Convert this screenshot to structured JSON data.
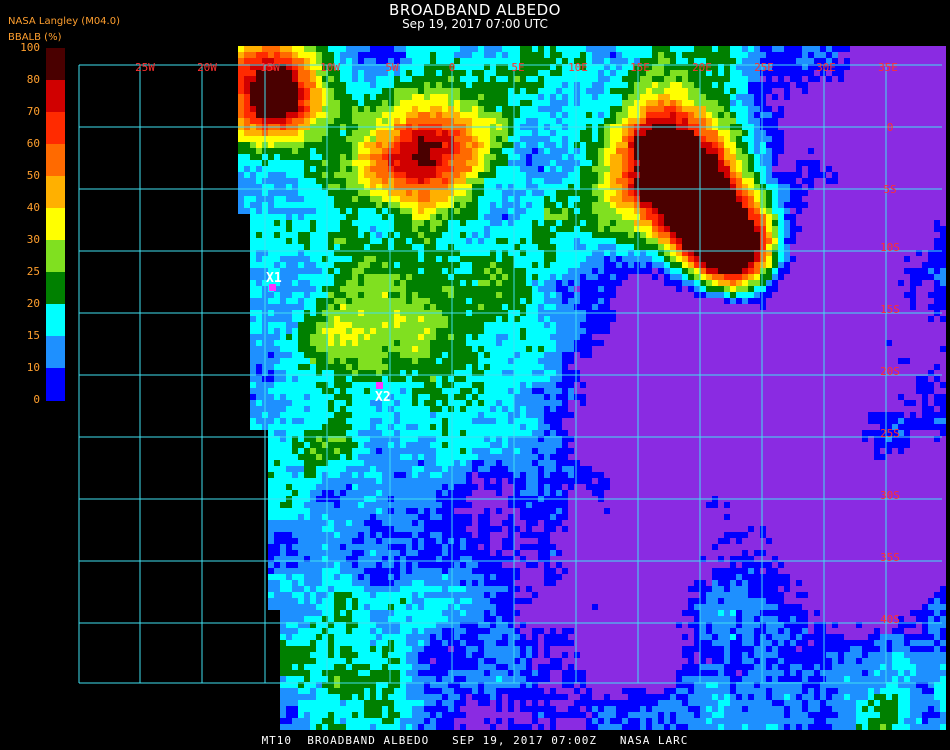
{
  "header": {
    "title": "BROADBAND ALBEDO",
    "subtitle": "Sep 19, 2017 07:00 UTC",
    "producer": "NASA Langley (M04.0)"
  },
  "colorbar": {
    "label": "BBALB (%)",
    "ticks": [
      "100",
      "80",
      "70",
      "60",
      "50",
      "40",
      "30",
      "25",
      "20",
      "15",
      "10",
      "0"
    ],
    "colors": [
      "#4a0000",
      "#d00000",
      "#ff2a00",
      "#ff6a00",
      "#ffb000",
      "#ffff00",
      "#80e020",
      "#008000",
      "#00ffff",
      "#1e90ff",
      "#0000ff",
      "#8a2be2"
    ]
  },
  "map": {
    "lon_labels": [
      "25W",
      "20W",
      "15W",
      "10W",
      "5W",
      "0",
      "5E",
      "10E",
      "15E",
      "20E",
      "25E",
      "30E",
      "35E"
    ],
    "lat_labels": [
      "0",
      "5S",
      "10S",
      "15S",
      "20S",
      "25S",
      "30S",
      "35S",
      "40S"
    ],
    "markers": [
      {
        "label": "X1",
        "color": "#ff33ff"
      },
      {
        "label": "X2",
        "color": "#ff33ff"
      }
    ],
    "grid_color": "#40e0f0"
  },
  "footer": {
    "text": "MT10  BROADBAND ALBEDO   SEP 19, 2017 07:00Z   NASA LARC"
  }
}
